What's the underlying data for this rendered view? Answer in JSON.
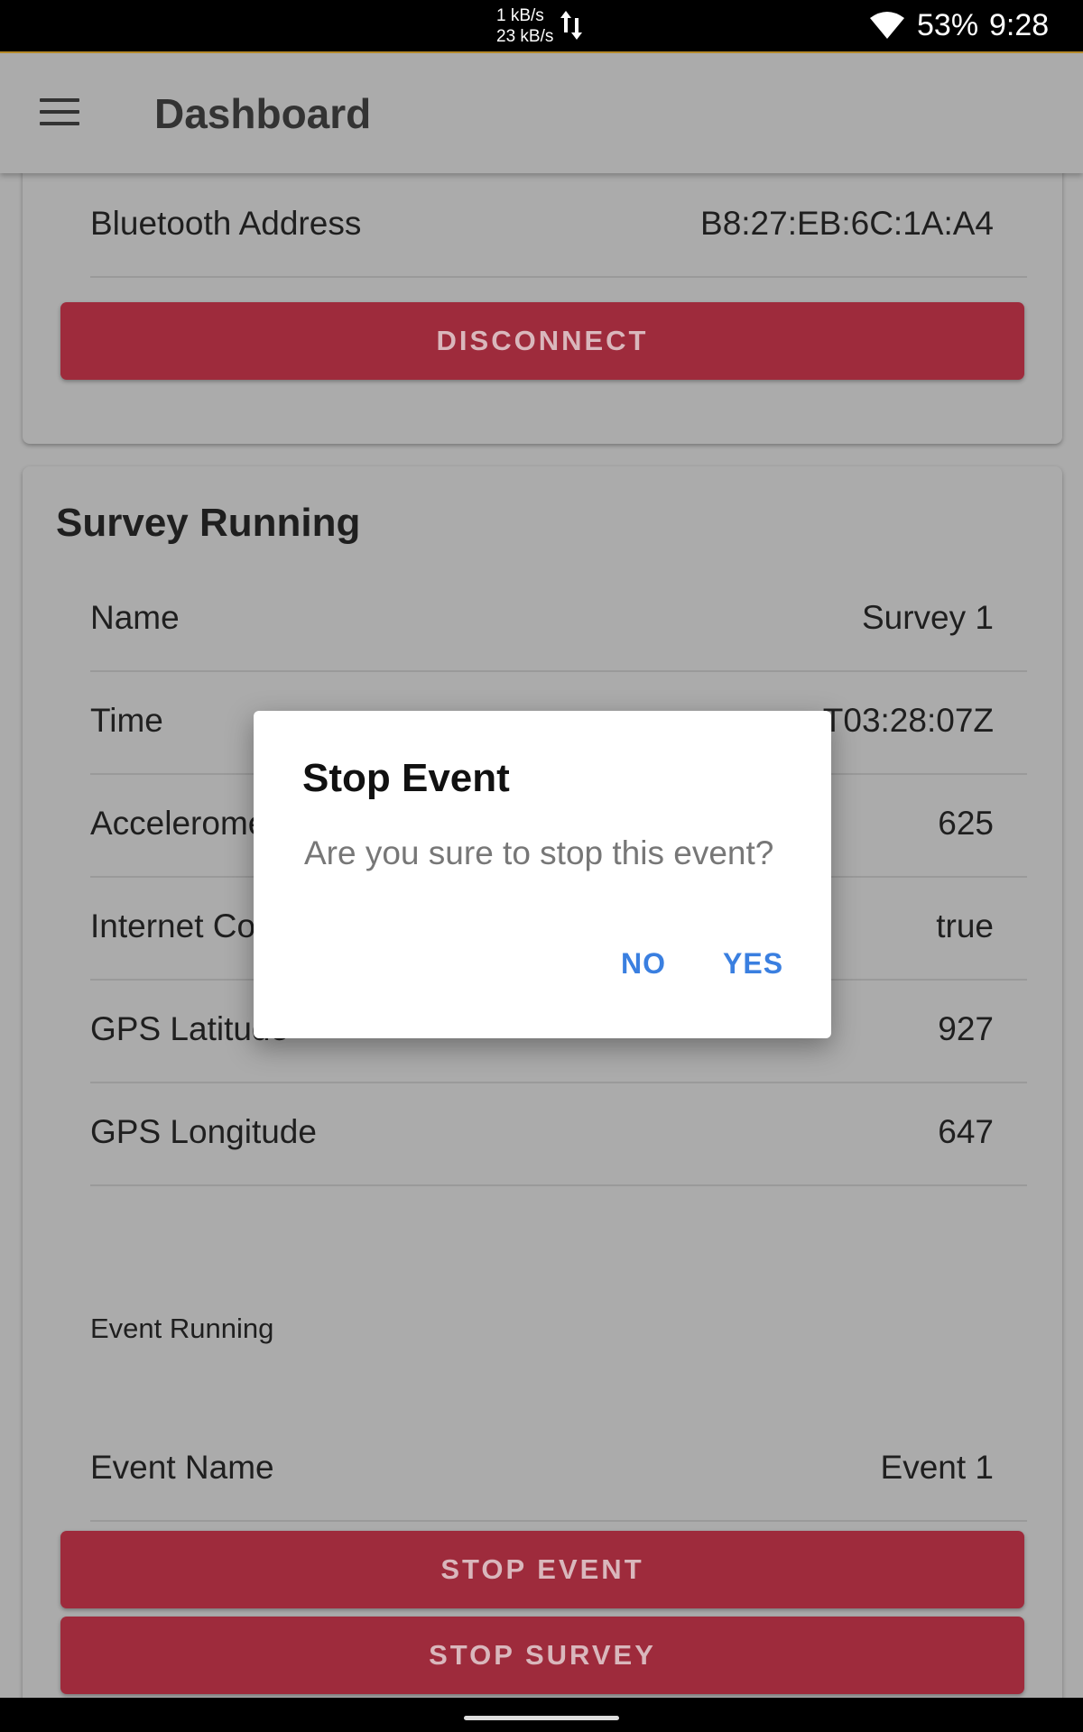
{
  "status_bar": {
    "net_up": "1 kB/s",
    "net_down": "23 kB/s",
    "battery": "53%",
    "time": "9:28"
  },
  "app_bar": {
    "title": "Dashboard"
  },
  "device_card": {
    "rows": [
      {
        "label": "Bluetooth Address",
        "value": "B8:27:EB:6C:1A:A4"
      }
    ],
    "disconnect_label": "DISCONNECT"
  },
  "survey_card": {
    "title": "Survey Running",
    "rows": [
      {
        "label": "Name",
        "value": "Survey 1"
      },
      {
        "label": "Time",
        "value": "T03:28:07Z"
      },
      {
        "label": "Acceleromete",
        "value": "625"
      },
      {
        "label": "Internet Co",
        "value": "true"
      },
      {
        "label": "GPS Latitude",
        "value": "927"
      },
      {
        "label": "GPS Longitude",
        "value": "647"
      }
    ],
    "event_section_label": "Event Running",
    "event_rows": [
      {
        "label": "Event Name",
        "value": "Event 1"
      }
    ],
    "stop_event_label": "STOP EVENT",
    "stop_survey_label": "STOP SURVEY"
  },
  "dialog": {
    "title": "Stop Event",
    "message": "Are you sure to stop this event?",
    "no_label": "NO",
    "yes_label": "YES"
  },
  "colors": {
    "accent_red": "#9e2b3c",
    "dialog_button": "#3a7fe0",
    "scrim_background": "#ababab"
  }
}
